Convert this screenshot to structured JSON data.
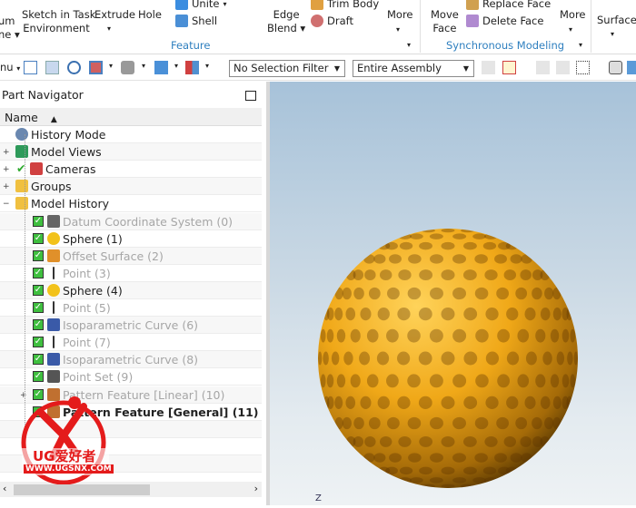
{
  "ribbon": {
    "datum_label": "um\nne ▾",
    "sketch_label": "Sketch in Task\nEnvironment",
    "extrude_label": "Extrude",
    "hole_label": "Hole",
    "unite_label": "Unite",
    "shell_label": "Shell",
    "edge_blend_label": "Edge\nBlend ▾",
    "trim_body_label": "Trim Body",
    "draft_label": "Draft",
    "more1_label": "More",
    "feature_group": "Feature",
    "move_face_label": "Move\nFace",
    "replace_face_label": "Replace Face",
    "delete_face_label": "Delete Face",
    "more2_label": "More",
    "sync_group": "Synchronous Modeling",
    "surface_label": "Surface"
  },
  "toolbar": {
    "menu_label": "nu",
    "selection_filter": "No Selection Filter",
    "scope": "Entire Assembly"
  },
  "navigator": {
    "title": "Part Navigator",
    "column_name": "Name",
    "items": [
      {
        "label": "History Mode",
        "icon": "clock-icon",
        "style": "normal"
      },
      {
        "label": "Model Views",
        "icon": "model-views-icon",
        "style": "normal"
      },
      {
        "label": "Cameras",
        "icon": "camera-icon",
        "style": "normal"
      },
      {
        "label": "Groups",
        "icon": "folder-icon",
        "style": "normal"
      },
      {
        "label": "Model History",
        "icon": "folder-icon",
        "style": "normal"
      },
      {
        "label": "Datum Coordinate System (0)",
        "icon": "datum-csys-icon",
        "style": "gray"
      },
      {
        "label": "Sphere (1)",
        "icon": "sphere-icon",
        "style": "normal"
      },
      {
        "label": "Offset Surface (2)",
        "icon": "offset-surface-icon",
        "style": "gray"
      },
      {
        "label": "Point (3)",
        "icon": "point-icon",
        "style": "gray"
      },
      {
        "label": "Sphere (4)",
        "icon": "sphere-icon",
        "style": "normal"
      },
      {
        "label": "Point (5)",
        "icon": "point-icon",
        "style": "gray"
      },
      {
        "label": "Isoparametric Curve (6)",
        "icon": "iso-curve-icon",
        "style": "gray"
      },
      {
        "label": "Point (7)",
        "icon": "point-icon",
        "style": "gray"
      },
      {
        "label": "Isoparametric Curve (8)",
        "icon": "iso-curve-icon",
        "style": "gray"
      },
      {
        "label": "Point Set (9)",
        "icon": "point-set-icon",
        "style": "gray"
      },
      {
        "label": "Pattern Feature [Linear] (10)",
        "icon": "pattern-icon",
        "style": "gray"
      },
      {
        "label": "Pattern Feature [General] (11)",
        "icon": "pattern-icon",
        "style": "bold"
      }
    ]
  },
  "viewport": {
    "axis_label": "Z",
    "model_color": "#e8a317"
  },
  "watermark": {
    "text1": "UG爱好者",
    "text2": "WWW.UGSNX.COM",
    "color": "#e41b1b"
  }
}
